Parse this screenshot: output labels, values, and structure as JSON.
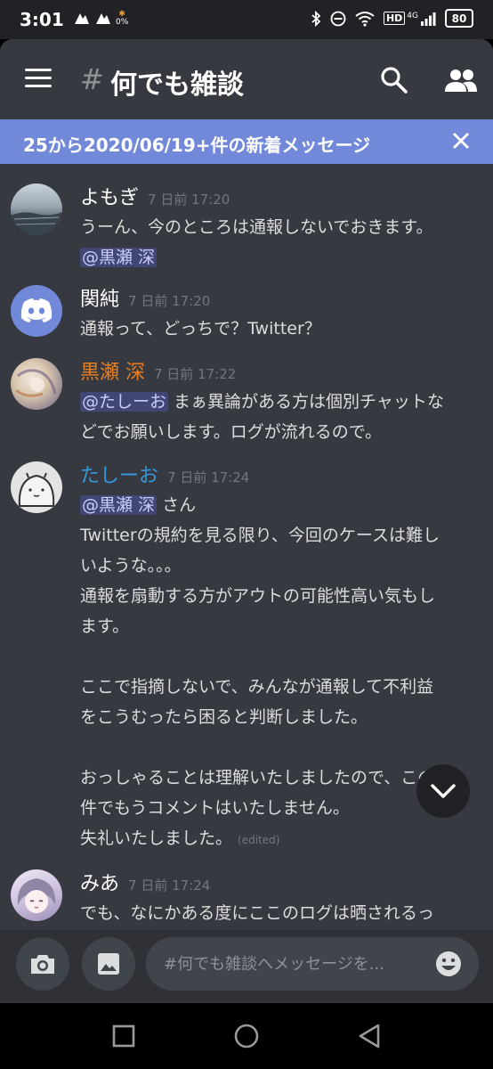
{
  "status_bar": {
    "time": "3:01",
    "small_data": "0%",
    "network": "4G",
    "hd": "HD",
    "battery": "80"
  },
  "header": {
    "hash": "#",
    "channel_name": "何でも雑談",
    "icons": [
      "menu-icon",
      "search-icon",
      "members-icon"
    ]
  },
  "banner": {
    "text": "25から2020/06/19+件の新着メッセージ"
  },
  "messages": [
    {
      "author": "よもぎ",
      "author_color": "#ffffff",
      "timestamp": "7 日前 17:20",
      "lines": [
        "うーん、今のところは通報しないでおきます。"
      ],
      "mention": "@黒瀬 深"
    },
    {
      "author": "関純",
      "author_color": "#ffffff",
      "timestamp": "7 日前 17:20",
      "lines": [
        "通報って、どっちで？Twitter？"
      ]
    },
    {
      "author": "黒瀬 深",
      "author_color": "#e67e22",
      "timestamp": "7 日前 17:22",
      "mention": "@たしーお",
      "line1_rest": " まぁ異論がある方は個別チャットな",
      "line2": "どでお願いします。ログが流れるので。"
    },
    {
      "author": "たしーお",
      "author_color": "#3498db",
      "timestamp": "7 日前 17:24",
      "mention": "@黒瀬 深",
      "mention_suffix": " さん",
      "lines": [
        "Twitterの規約を見る限り、今回のケースは難し",
        "いような。。。",
        "通報を扇動する方がアウトの可能性高い気もし",
        "ます。",
        "",
        "ここで指摘しないで、みんなが通報して不利益",
        "をこうむったら困ると判断しました。",
        "",
        "おっしゃることは理解いたしましたので、この",
        "件でもうコメントはいたしません。"
      ],
      "last_line": "失礼いたしました。",
      "edited": "(edited)"
    },
    {
      "author": "みあ",
      "author_color": "#ffffff",
      "timestamp": "7 日前 17:24",
      "lines": [
        "でも、なにかある度にここのログは晒されるっ"
      ]
    }
  ],
  "composer": {
    "placeholder": "#何でも雑談へメッセージを...",
    "icons": [
      "camera-icon",
      "image-icon",
      "emoji-icon"
    ]
  },
  "navbar": {
    "icons": [
      "recents-icon",
      "home-icon",
      "back-icon"
    ]
  },
  "colors": {
    "background": "#36393f",
    "banner": "#7289da",
    "mention_bg": "#414675",
    "composer": "#2f3136"
  }
}
